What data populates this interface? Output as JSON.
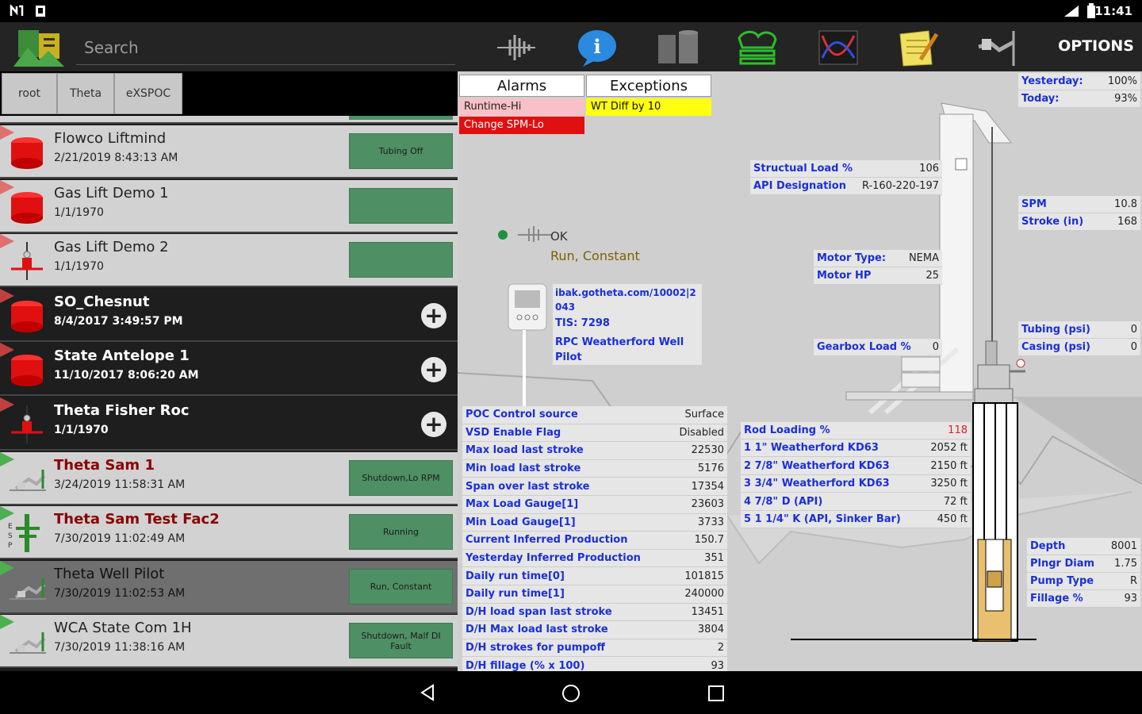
{
  "status_bar": {
    "time": "11:41"
  },
  "toolbar": {
    "search_placeholder": "Search",
    "options_label": "OPTIONS",
    "icons": [
      "app-logo-icon",
      "signal-icon",
      "info-icon",
      "tank-icon",
      "pump-icon",
      "chart-icon",
      "notes-icon",
      "wrench-icon"
    ]
  },
  "breadcrumb": [
    "root",
    "Theta",
    "eXSPOC"
  ],
  "wells": [
    {
      "name": "Flowco Liftmind",
      "date": "2/21/2019 8:43:13 AM",
      "status": "Tubing Off",
      "theme": "light",
      "icon": "red-cube-icon"
    },
    {
      "name": "Gas Lift Demo 1",
      "date": "1/1/1970",
      "status": "",
      "theme": "light",
      "icon": "red-cube-icon"
    },
    {
      "name": "Gas Lift Demo 2",
      "date": "1/1/1970",
      "status": "",
      "theme": "light",
      "icon": "wellhead-icon"
    },
    {
      "name": "SO_Chesnut",
      "date": "8/4/2017 3:49:57 PM",
      "status": "",
      "theme": "dark",
      "icon": "red-cube-icon"
    },
    {
      "name": "State Antelope 1",
      "date": "11/10/2017 8:06:20 AM",
      "status": "",
      "theme": "dark",
      "icon": "red-cube-icon"
    },
    {
      "name": "Theta Fisher Roc",
      "date": "1/1/1970",
      "status": "",
      "theme": "dark",
      "icon": "wellhead-icon"
    },
    {
      "name": "Theta Sam 1",
      "date": "3/24/2019 11:58:31 AM",
      "status": "Shutdown,Lo RPM",
      "theme": "light",
      "icon": "pumpjack-icon"
    },
    {
      "name": "Theta Sam Test Fac2",
      "date": "7/30/2019 11:02:49 AM",
      "status": "Running",
      "theme": "light",
      "icon": "esp-icon"
    },
    {
      "name": "Theta Well Pilot",
      "date": "7/30/2019 11:02:53 AM",
      "status": "Run, Constant",
      "theme": "selected",
      "icon": "pumpjack-icon"
    },
    {
      "name": "WCA State Com 1H",
      "date": "7/30/2019 11:38:16 AM",
      "status": "Shutdown, Malf DI Fault",
      "theme": "light",
      "icon": "pumpjack-icon"
    }
  ],
  "alarms": {
    "header": "Alarms",
    "items": [
      "Runtime-Hi",
      "Change SPM-Lo"
    ]
  },
  "exceptions": {
    "header": "Exceptions",
    "items": [
      "WT Diff by 10"
    ]
  },
  "controller": {
    "state": "OK",
    "mode": "Run, Constant",
    "address": "ibak.gotheta.com/10002|2043",
    "tis": "TIS: 7298",
    "type": "RPC Weatherford Well Pilot"
  },
  "runtime": [
    {
      "label": "Yesterday:",
      "value": "100%"
    },
    {
      "label": "Today:",
      "value": "93%"
    }
  ],
  "structural": [
    {
      "label": "Structual Load %",
      "value": "106"
    },
    {
      "label": "API Designation",
      "value": "R-160-220-197"
    }
  ],
  "spm": [
    {
      "label": "SPM",
      "value": "10.8"
    },
    {
      "label": "Stroke (in)",
      "value": "168"
    }
  ],
  "motor": [
    {
      "label": "Motor Type:",
      "value": "NEMA"
    },
    {
      "label": "Motor HP",
      "value": "25"
    }
  ],
  "gearbox": {
    "label": "Gearbox Load %",
    "value": "0"
  },
  "pressure": [
    {
      "label": "Tubing (psi)",
      "value": "0"
    },
    {
      "label": "Casing (psi)",
      "value": "0"
    }
  ],
  "pump": [
    {
      "label": "Depth",
      "value": "8001"
    },
    {
      "label": "Plngr Diam",
      "value": "1.75"
    },
    {
      "label": "Pump Type",
      "value": "R"
    },
    {
      "label": "Fillage %",
      "value": "93"
    }
  ],
  "rod_loading": {
    "label": "Rod Loading %",
    "value": "118",
    "rods": [
      {
        "label": "1  1\" Weatherford KD63",
        "value": "2052 ft"
      },
      {
        "label": "2  7/8\" Weatherford KD63",
        "value": "2150 ft"
      },
      {
        "label": "3  3/4\" Weatherford KD63",
        "value": "3250 ft"
      },
      {
        "label": "4  7/8\" D (API)",
        "value": "72 ft"
      },
      {
        "label": "5  1 1/4\" K (API, Sinker Bar)",
        "value": "450 ft"
      }
    ]
  },
  "params": [
    {
      "label": "POC Control source",
      "value": "Surface"
    },
    {
      "label": "VSD Enable Flag",
      "value": "Disabled"
    },
    {
      "label": "Max load last stroke",
      "value": "22530"
    },
    {
      "label": "Min load last stroke",
      "value": "5176"
    },
    {
      "label": "Span over last stroke",
      "value": "17354"
    },
    {
      "label": "Max Load Gauge[1]",
      "value": "23603"
    },
    {
      "label": "Min Load Gauge[1]",
      "value": "3733"
    },
    {
      "label": "Current Inferred Production",
      "value": "150.7"
    },
    {
      "label": "Yesterday Inferred Production",
      "value": "351"
    },
    {
      "label": "Daily run time[0]",
      "value": "101815"
    },
    {
      "label": "Daily run time[1]",
      "value": "240000"
    },
    {
      "label": "D/H load span last stroke",
      "value": "13451"
    },
    {
      "label": "D/H Max load last stroke",
      "value": "3804"
    },
    {
      "label": "D/H strokes for pumpoff",
      "value": "2"
    },
    {
      "label": "D/H fillage (% x 100)",
      "value": "93"
    }
  ]
}
